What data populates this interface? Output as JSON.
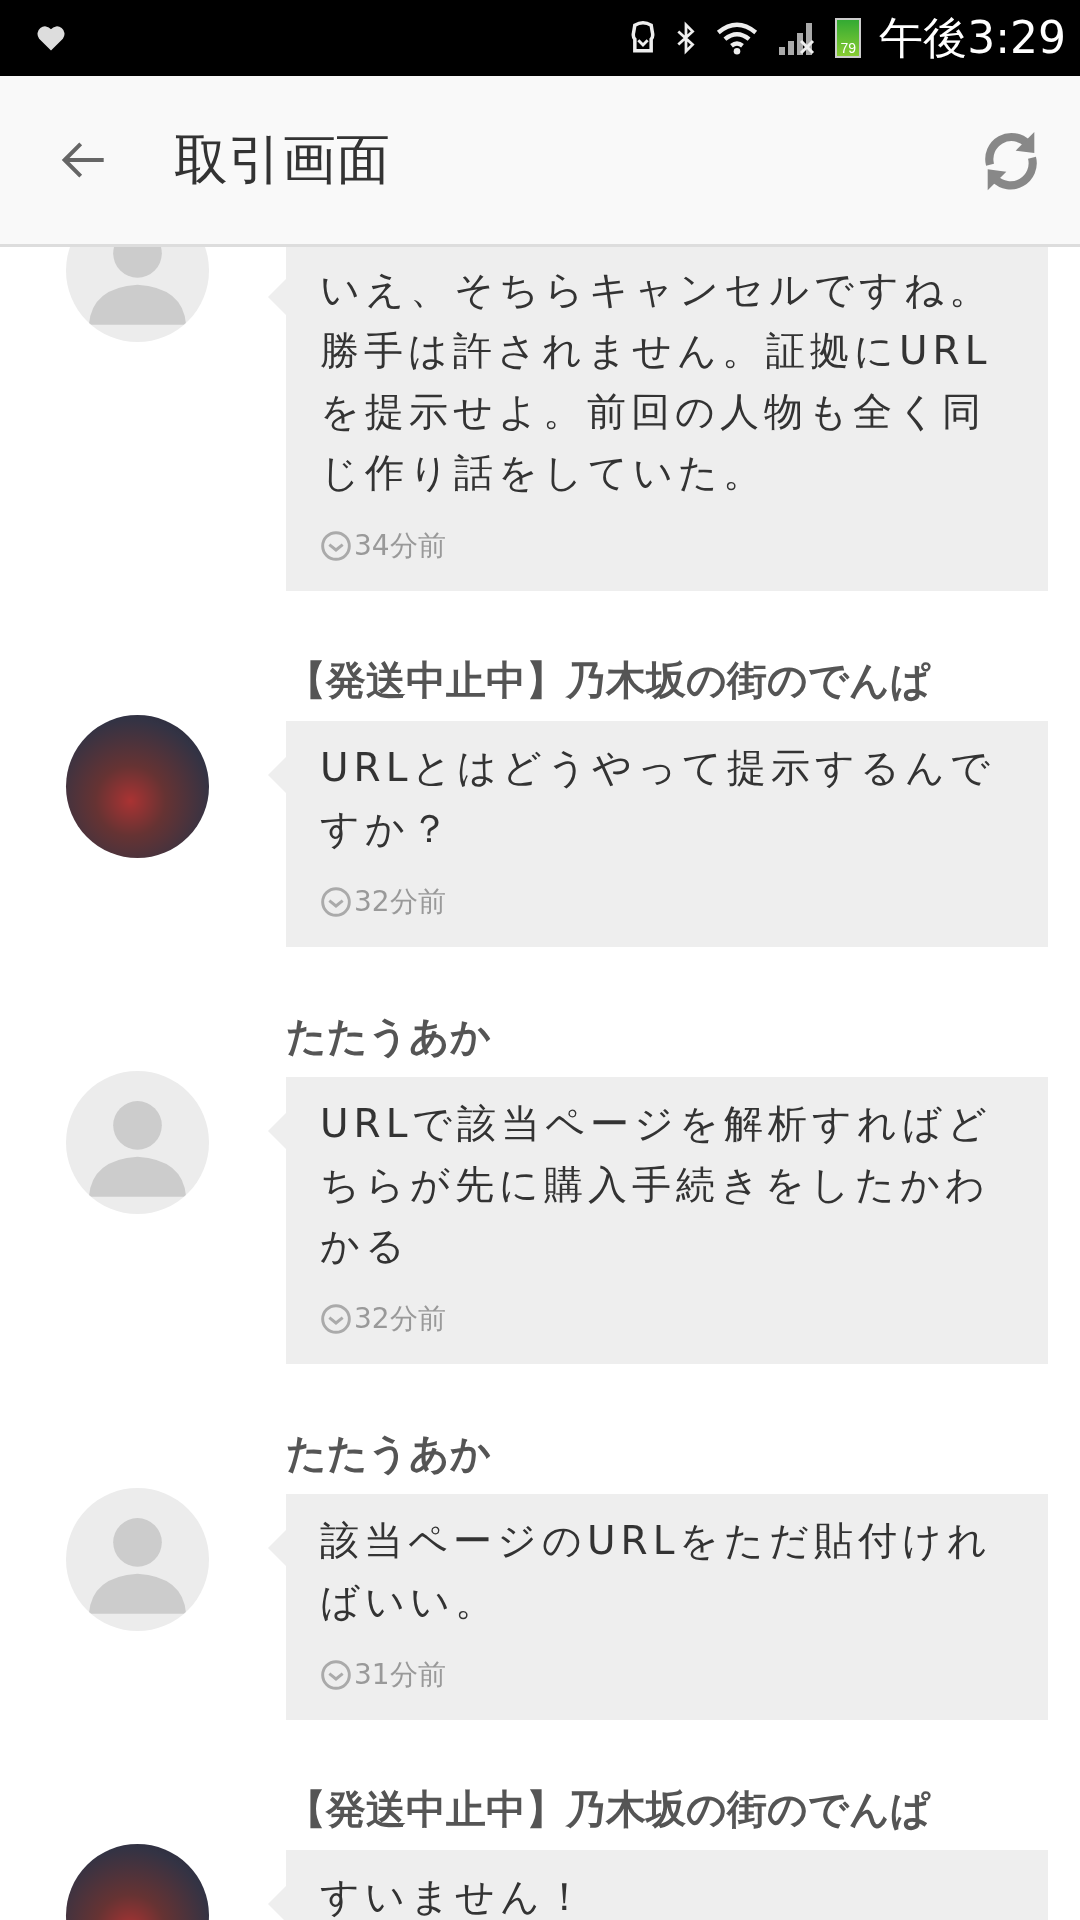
{
  "status_bar": {
    "battery": "79",
    "time": "午後3:29"
  },
  "header": {
    "title": "取引画面"
  },
  "messages": [
    {
      "kind": "default",
      "body": "いえ、そちらキャンセルですね。勝手は許されません。証拠にURLを提示せよ。前回の人物も全く同じ作り話をしていた。",
      "time": "34分前"
    },
    {
      "kind": "photo",
      "name": "【発送中止中】乃木坂の街のでんぱ",
      "body": "URLとはどうやって提示するんですか？",
      "time": "32分前"
    },
    {
      "kind": "default",
      "name": "たたうあか",
      "body": "URLで該当ページを解析すればどちらが先に購入手続きをしたかわかる",
      "time": "32分前"
    },
    {
      "kind": "default",
      "name": "たたうあか",
      "body": "該当ページのURLをただ貼付ければいい。",
      "time": "31分前"
    },
    {
      "kind": "photo",
      "name": "【発送中止中】乃木坂の街のでんぱ",
      "body": "すいません！"
    }
  ]
}
